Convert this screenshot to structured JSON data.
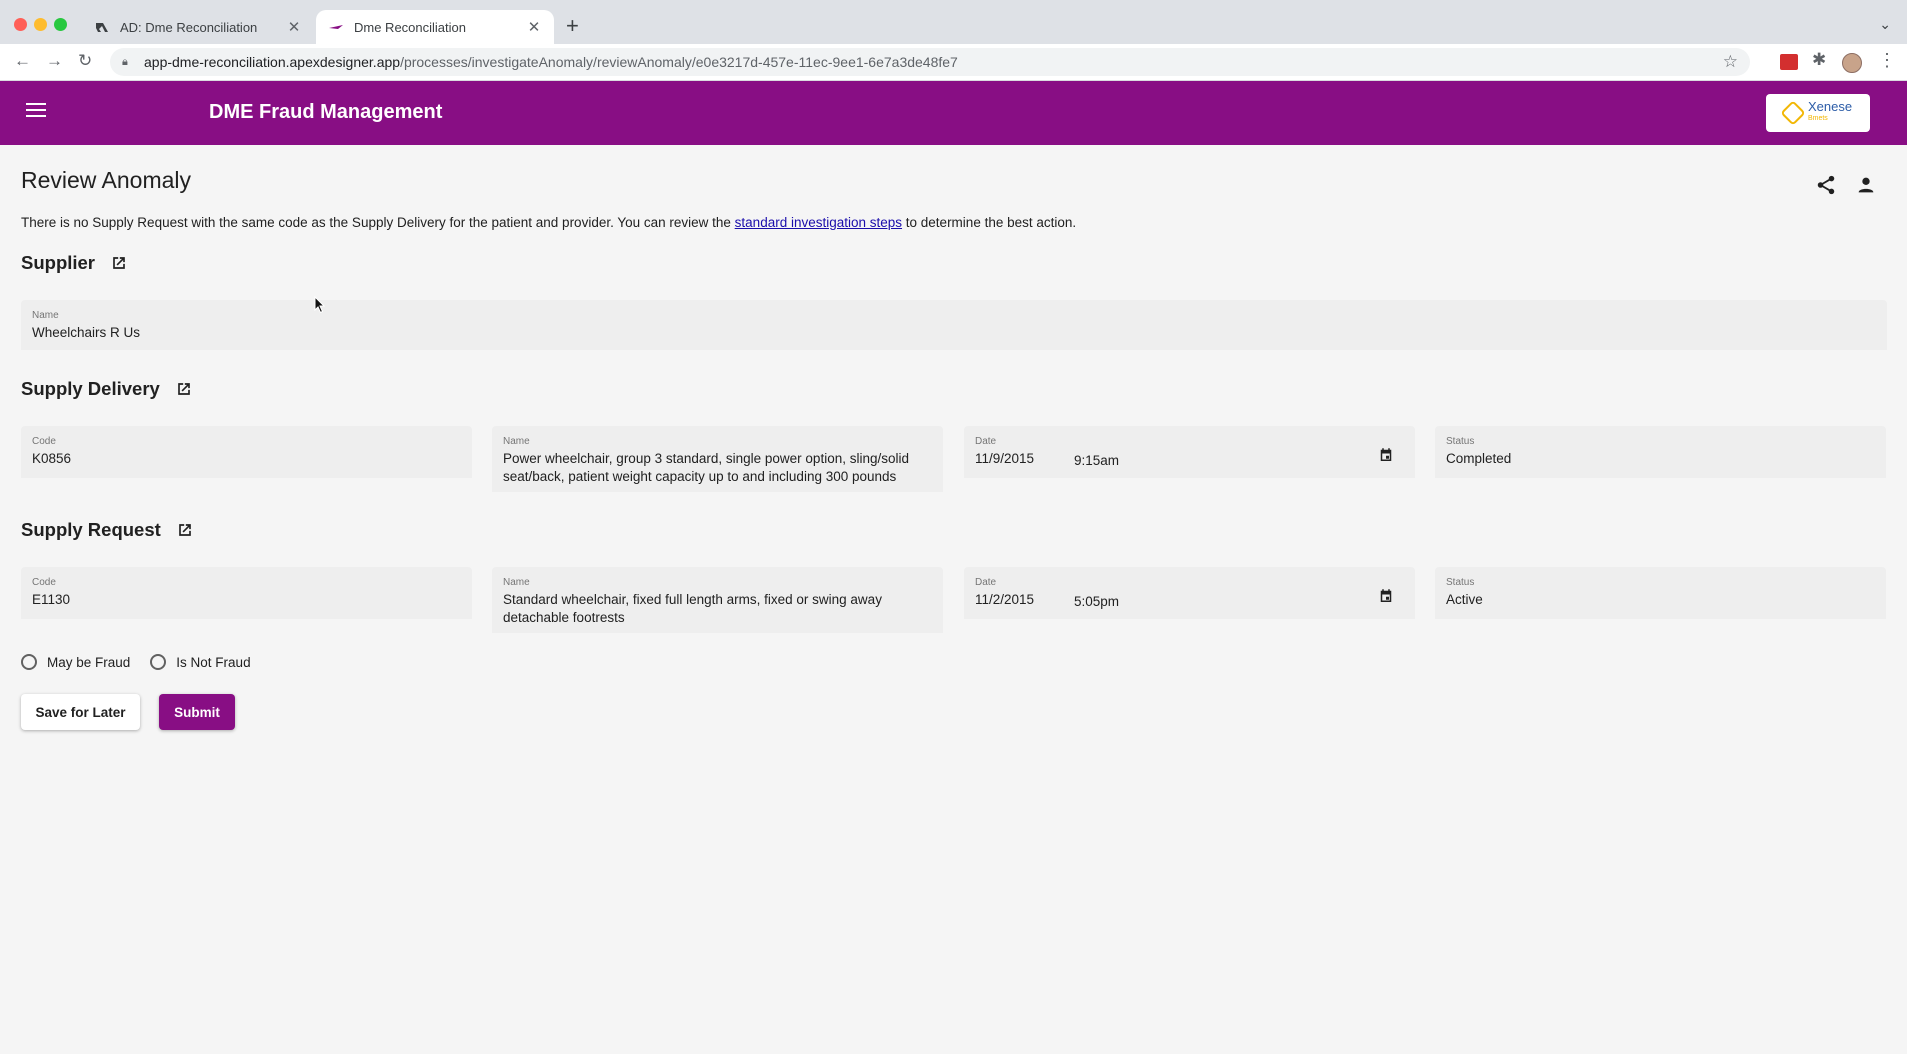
{
  "browser": {
    "tabs": [
      {
        "title": "AD: Dme Reconciliation",
        "close": "✕"
      },
      {
        "title": "Dme Reconciliation",
        "close": "✕"
      }
    ],
    "new_tab": "+",
    "url_host": "app-dme-reconciliation.apexdesigner.app",
    "url_path": "/processes/investigateAnomaly/reviewAnomaly/e0e3217d-457e-11ec-9ee1-6e7a3de48fe7"
  },
  "header": {
    "title": "DME Fraud Management",
    "logo_text": "Xenese",
    "logo_sub": "Bmets"
  },
  "page": {
    "title": "Review Anomaly",
    "intro_before": "There is no Supply Request with the same code as the Supply Delivery for the patient and provider. You can review the ",
    "intro_link": "standard investigation steps",
    "intro_after": " to determine the best action."
  },
  "supplier": {
    "section_title": "Supplier",
    "name_label": "Name",
    "name_value": "Wheelchairs R Us"
  },
  "supply_delivery": {
    "section_title": "Supply Delivery",
    "code_label": "Code",
    "code_value": "K0856",
    "name_label": "Name",
    "name_value": "Power wheelchair, group 3 standard, single power option, sling/solid seat/back, patient weight capacity up to and including 300 pounds",
    "date_label": "Date",
    "date_value": "11/9/2015",
    "time_value": "9:15am",
    "status_label": "Status",
    "status_value": "Completed"
  },
  "supply_request": {
    "section_title": "Supply Request",
    "code_label": "Code",
    "code_value": "E1130",
    "name_label": "Name",
    "name_value": "Standard wheelchair, fixed full length arms, fixed or swing away detachable footrests",
    "date_label": "Date",
    "date_value": "11/2/2015",
    "time_value": "5:05pm",
    "status_label": "Status",
    "status_value": "Active"
  },
  "decision": {
    "option_1": "May be Fraud",
    "option_2": "Is Not Fraud"
  },
  "actions": {
    "save_label": "Save for Later",
    "submit_label": "Submit"
  },
  "colors": {
    "brand": "#880e84",
    "link": "#1a0dab"
  }
}
